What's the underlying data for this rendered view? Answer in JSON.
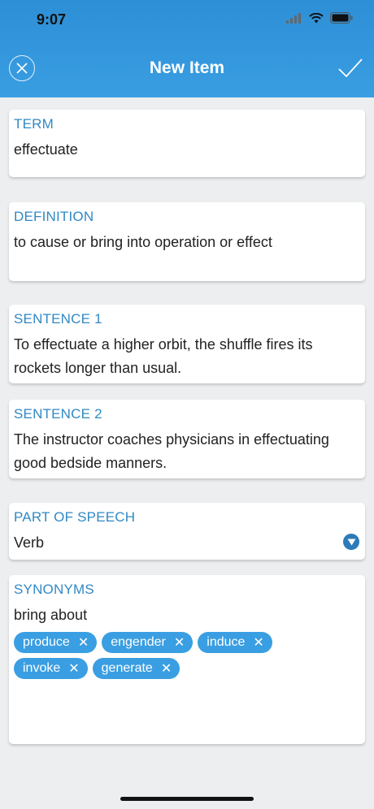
{
  "status": {
    "time": "9:07"
  },
  "header": {
    "title": "New Item"
  },
  "term": {
    "label": "TERM",
    "value": "effectuate"
  },
  "definition": {
    "label": "DEFINITION",
    "value": "to cause or bring into operation or effect"
  },
  "sentence1": {
    "label": "SENTENCE 1",
    "value": "To effectuate a higher orbit, the shuffle fires its rockets longer than usual."
  },
  "sentence2": {
    "label": "SENTENCE 2",
    "value": "The instructor coaches physicians in effectuating good bedside manners."
  },
  "part_of_speech": {
    "label": "PART OF SPEECH",
    "value": "Verb"
  },
  "synonyms": {
    "label": "SYNONYMS",
    "input_value": "bring about",
    "chips": [
      "produce",
      "engender",
      "induce",
      "invoke",
      "generate"
    ],
    "remove_glyph": "✕"
  },
  "colors": {
    "accent": "#3a9ee2",
    "label": "#3189c4"
  }
}
